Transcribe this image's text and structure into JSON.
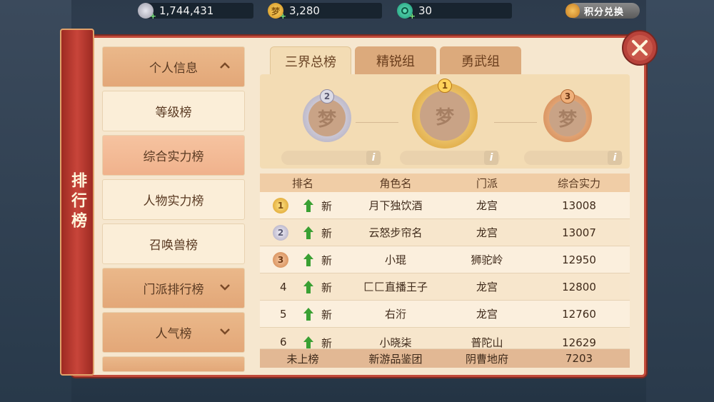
{
  "currencies": [
    {
      "icon": "silver-coin-icon",
      "value": "1,744,431"
    },
    {
      "icon": "gold-coin-icon",
      "value": "3,280",
      "badge": "梦"
    },
    {
      "icon": "jade-icon",
      "value": "30"
    }
  ],
  "exchange_label": "积分兑换",
  "title": "排行榜",
  "menu": [
    {
      "label": "个人信息",
      "type": "header",
      "chevron": "up"
    },
    {
      "label": "等级榜",
      "type": "item"
    },
    {
      "label": "综合实力榜",
      "type": "active"
    },
    {
      "label": "人物实力榜",
      "type": "item"
    },
    {
      "label": "召唤兽榜",
      "type": "item"
    },
    {
      "label": "门派排行榜",
      "type": "header",
      "chevron": "down"
    },
    {
      "label": "人气榜",
      "type": "header",
      "chevron": "down"
    }
  ],
  "tabs": [
    {
      "label": "三界总榜",
      "active": true
    },
    {
      "label": "精锐组",
      "active": false
    },
    {
      "label": "勇武组",
      "active": false
    }
  ],
  "podium": {
    "first": "1",
    "second": "2",
    "third": "3",
    "placeholder_glyph": "梦",
    "info": "i"
  },
  "table": {
    "headers": [
      "排名",
      "角色名",
      "门派",
      "综合实力"
    ],
    "rows": [
      {
        "rank": "1",
        "trend": "新",
        "name": "月下独饮酒",
        "school": "龙宫",
        "power": "13008"
      },
      {
        "rank": "2",
        "trend": "新",
        "name": "云怒步帘名",
        "school": "龙宫",
        "power": "13007"
      },
      {
        "rank": "3",
        "trend": "新",
        "name": "小琨",
        "school": "狮驼岭",
        "power": "12950"
      },
      {
        "rank": "4",
        "trend": "新",
        "name": "匚匚直播王子",
        "school": "龙宫",
        "power": "12800"
      },
      {
        "rank": "5",
        "trend": "新",
        "name": "右洐",
        "school": "龙宫",
        "power": "12760"
      },
      {
        "rank": "6",
        "trend": "新",
        "name": "小晓柒",
        "school": "普陀山",
        "power": "12629"
      }
    ],
    "self": {
      "rank": "未上榜",
      "name": "新游品鉴团",
      "school": "阴曹地府",
      "power": "7203"
    }
  },
  "colors": {
    "gold": "#e7b23f",
    "silver": "#b9b6c6",
    "bronze": "#d08a50",
    "arrow": "#3aa033",
    "accent_red": "#c24a3a"
  }
}
